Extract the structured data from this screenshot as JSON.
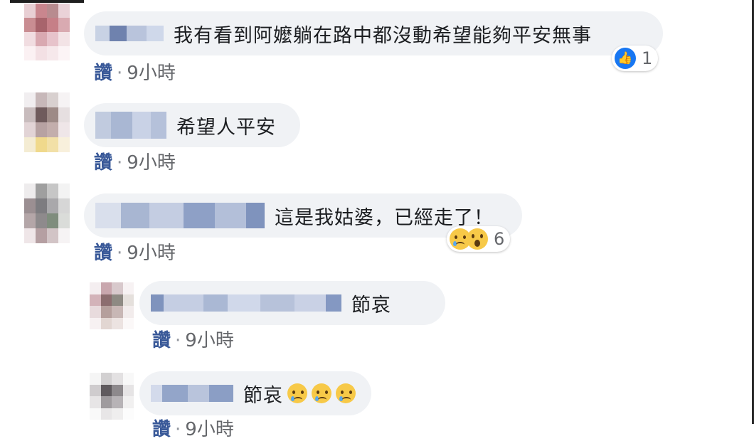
{
  "comments": [
    {
      "text": "我有看到阿嬤躺在路中都沒動希望能夠平安無事",
      "like_label": "讚",
      "separator": "·",
      "time": "9小時",
      "reaction_count": "1",
      "reactions": [
        "like"
      ]
    },
    {
      "text": "希望人平安",
      "like_label": "讚",
      "separator": "·",
      "time": "9小時"
    },
    {
      "text": "這是我姑婆，已經走了！",
      "like_label": "讚",
      "separator": "·",
      "time": "9小時",
      "reaction_count": "6",
      "reactions": [
        "sad",
        "wow"
      ]
    }
  ],
  "replies": [
    {
      "text": "節哀",
      "like_label": "讚",
      "separator": "·",
      "time": "9小時"
    },
    {
      "text": "節哀",
      "emoji": [
        "sad",
        "sad",
        "sad"
      ],
      "like_label": "讚",
      "separator": "·",
      "time": "9小時"
    }
  ],
  "colors": {
    "bubble_bg": "#f0f2f5",
    "like_link": "#385898",
    "meta_gray": "#65676b",
    "like_blue": "#1877f2",
    "emoji_yellow": "#f7c948"
  }
}
